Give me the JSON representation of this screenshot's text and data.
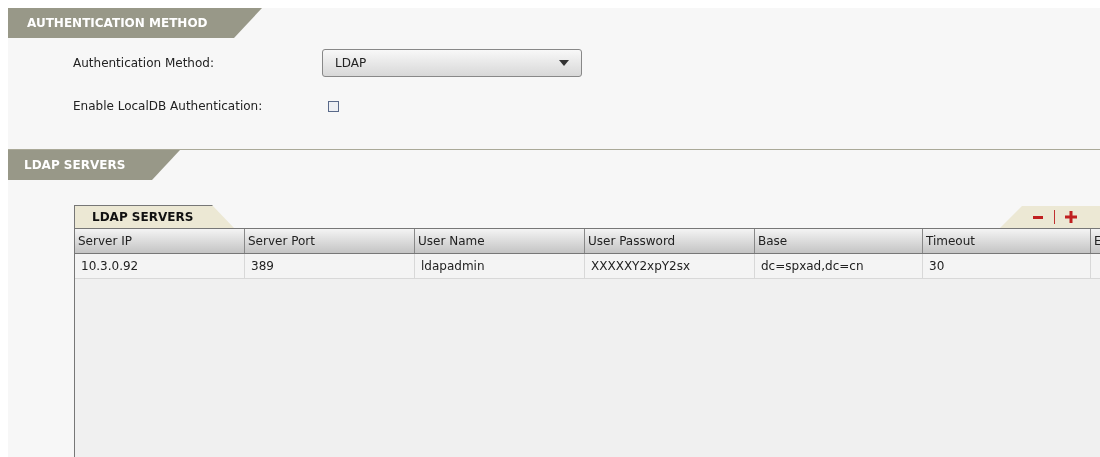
{
  "auth_section": {
    "title": "AUTHENTICATION METHOD",
    "method": {
      "label": "Authentication Method:",
      "value": "LDAP"
    },
    "localdb": {
      "label": "Enable LocalDB Authentication:",
      "checked": false
    }
  },
  "ldap_section": {
    "title": "LDAP SERVERS",
    "tab": {
      "label": "LDAP SERVERS"
    },
    "actions": [
      {
        "kind": "remove"
      },
      {
        "kind": "add"
      }
    ],
    "table": {
      "columns": [
        "Server IP",
        "Server Port",
        "User Name",
        "User Password",
        "Base",
        "Timeout",
        "E"
      ],
      "rows": [
        [
          "10.3.0.92",
          "389",
          "ldapadmin",
          "XXXXXY2xpY2sx",
          "dc=spxad,dc=cn",
          "30",
          ""
        ]
      ]
    }
  }
}
